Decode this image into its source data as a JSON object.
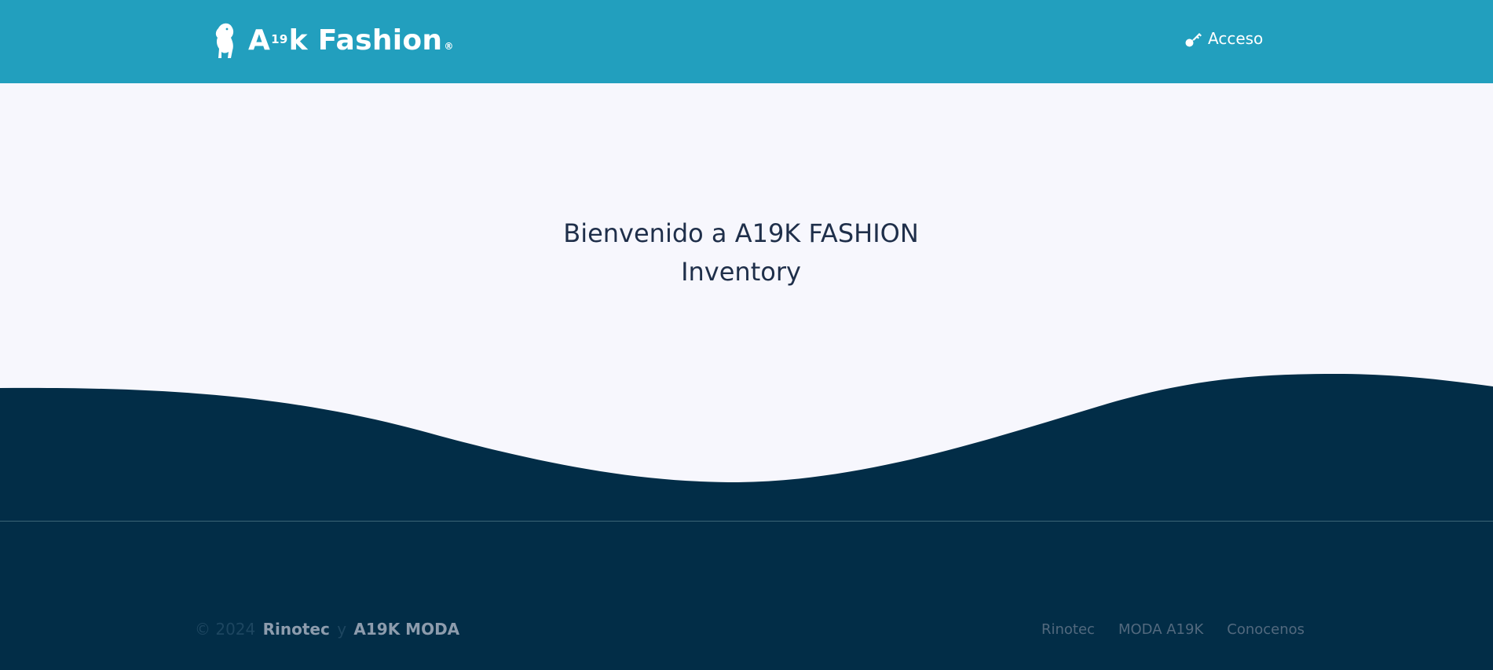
{
  "header": {
    "brand": {
      "text_a": "A",
      "text_sup": "19",
      "text_k": "k Fashion",
      "registered": "®"
    },
    "login_label": "Acceso",
    "login_icon": "key-icon"
  },
  "hero": {
    "title_line1": "Bienvenido a A19K FASHION",
    "title_line2": "Inventory"
  },
  "footer": {
    "copyright_prefix": "© 2024",
    "copyright_link1": "Rinotec",
    "copyright_conjunction": "y",
    "copyright_link2": "A19K MODA",
    "links": [
      "Rinotec",
      "MODA A19K",
      "Conocenos"
    ]
  },
  "colors": {
    "header_bg": "#229fbe",
    "page_bg": "#f7f7fd",
    "footer_bg": "#022d47",
    "title_text": "#1f2f4a"
  }
}
